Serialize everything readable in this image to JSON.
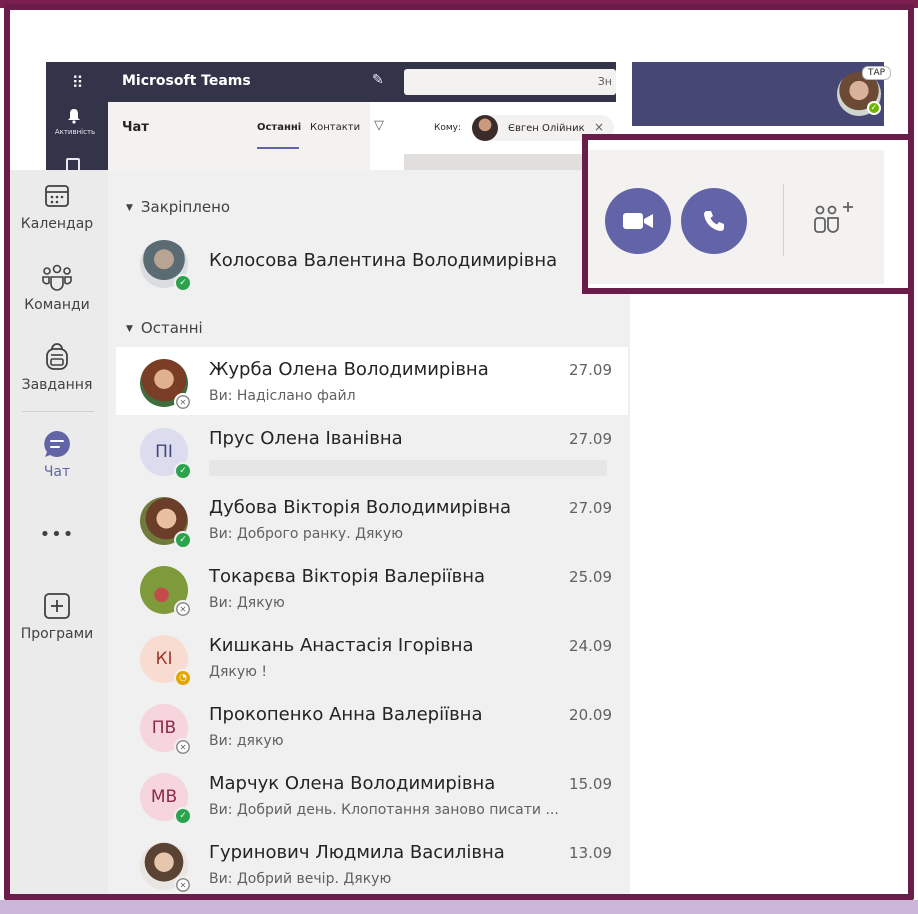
{
  "window": {
    "app_title": "Microsoft Teams",
    "search_hint": "Зн",
    "waffle_glyph": "⠿"
  },
  "bg_rail": {
    "activity_label": "Активність"
  },
  "bg_chat": {
    "title": "Чат",
    "tab_recent": "Останні",
    "tab_contacts": "Контакти"
  },
  "compose": {
    "to_label": "Кому:",
    "recipient": "Євген Олійник",
    "close_glyph": "×"
  },
  "user": {
    "badge": "ТАР"
  },
  "rail": {
    "items": [
      {
        "label": "Календар",
        "icon": "calendar-icon"
      },
      {
        "label": "Команди",
        "icon": "teams-icon"
      },
      {
        "label": "Завдання",
        "icon": "backpack-icon"
      },
      {
        "label": "Чат",
        "icon": "chat-icon"
      },
      {
        "label": "•••",
        "icon": "more-icon"
      },
      {
        "label": "Програми",
        "icon": "apps-icon"
      }
    ]
  },
  "sections": {
    "pinned": "Закріплено",
    "recent": "Останні"
  },
  "pinned": [
    {
      "name": "Колосова Валентина Володимирівна",
      "status": "available"
    }
  ],
  "chats": [
    {
      "name": "Журба Олена Володимирівна",
      "preview": "Ви: Надіслано файл",
      "date": "27.09",
      "status": "offline",
      "initials": "",
      "avatar_color": "#a0643f"
    },
    {
      "name": "Прус Олена Іванівна",
      "preview": "",
      "date": "27.09",
      "status": "available",
      "initials": "ПІ",
      "avatar_color": "#dcdcef",
      "initials_color": "#44457a"
    },
    {
      "name": "Дубова Вікторія Володимирівна",
      "preview": "Ви: Доброго ранку. Дякую",
      "date": "27.09",
      "status": "available",
      "initials": "",
      "avatar_color": "#6f7a3b"
    },
    {
      "name": "Токарєва Вікторія Валеріївна",
      "preview": "Ви: Дякую",
      "date": "25.09",
      "status": "offline",
      "initials": "",
      "avatar_color": "#7f9a3a"
    },
    {
      "name": "Кишкань Анастасія Ігорівна",
      "preview": "Дякую !",
      "date": "24.09",
      "status": "away",
      "initials": "КІ",
      "avatar_color": "#f8dcd2",
      "initials_color": "#9b3a2a"
    },
    {
      "name": "Прокопенко Анна Валеріївна",
      "preview": "Ви: дякую",
      "date": "20.09",
      "status": "offline",
      "initials": "ПВ",
      "avatar_color": "#f6d5dd",
      "initials_color": "#8a2a48"
    },
    {
      "name": "Марчук Олена Володимирівна",
      "preview": "Ви: Добрий день. Клопотання заново писати ...",
      "date": "15.09",
      "status": "available",
      "initials": "МВ",
      "avatar_color": "#f6d5dd",
      "initials_color": "#8a2a48"
    },
    {
      "name": "Гуринович Людмила Василівна",
      "preview": "Ви: Добрий вечір. Дякую",
      "date": "13.09",
      "status": "offline",
      "initials": "",
      "avatar_color": "#c9c3bb"
    }
  ],
  "colors": {
    "frame": "#6b1d49",
    "accent": "#6264a7",
    "titlebar": "#33344a",
    "available": "#2ba24c",
    "away": "#e3a400"
  }
}
